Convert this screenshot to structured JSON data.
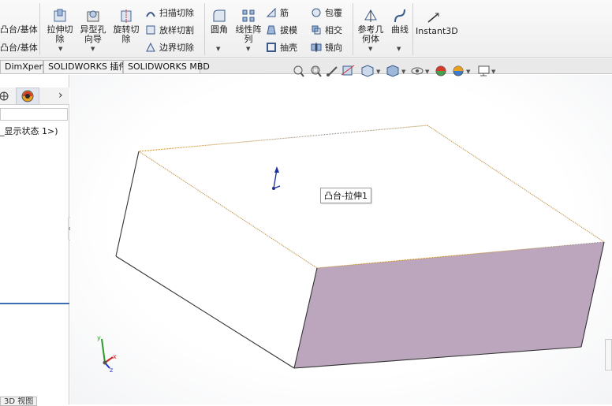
{
  "ribbon": {
    "boss_base_1": "凸台/基体",
    "boss_base_2": "凸台/基体",
    "extruded_cut_line1": "拉伸切",
    "extruded_cut_line2": "除",
    "hole_wizard_line1": "异型孔",
    "hole_wizard_line2": "向导",
    "revolved_cut_line1": "旋转切",
    "revolved_cut_line2": "除",
    "swept_cut": "扫描切除",
    "lofted_cut": "放样切割",
    "boundary_cut": "边界切除",
    "fillet": "圆角",
    "linear_pattern_line1": "线性阵",
    "linear_pattern_line2": "列",
    "rib": "筋",
    "draft": "拔模",
    "shell": "抽壳",
    "wrap": "包覆",
    "intersect": "相交",
    "mirror": "镜向",
    "ref_geometry_line1": "参考几",
    "ref_geometry_line2": "何体",
    "curves": "曲线",
    "instant3d": "Instant3D"
  },
  "tabs": [
    "DimXpert",
    "SOLIDWORKS 插件",
    "SOLIDWORKS MBD"
  ],
  "feature_tree": {
    "display_state_item": "_显示状态 1>)"
  },
  "viewport": {
    "feature_label": "凸台-拉伸1"
  },
  "bottom_tab": "3D 视图",
  "colors": {
    "top_face": "#ffffff",
    "front_face": "#bba6be",
    "edge_highlight": "#b9893a",
    "panel_accent": "#3c6fb4"
  }
}
